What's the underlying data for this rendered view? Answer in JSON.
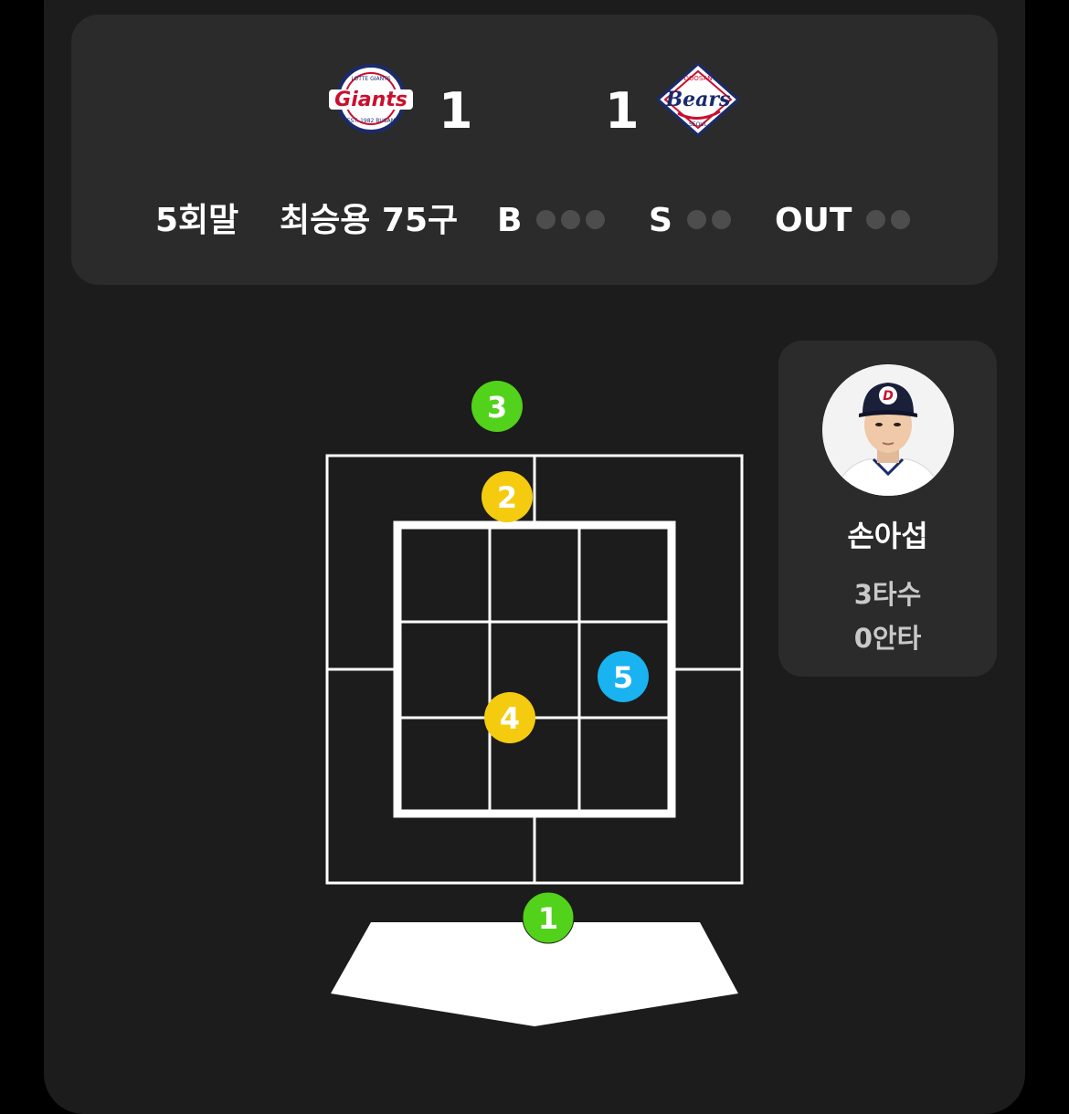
{
  "scoreboard": {
    "away_team": {
      "logo_icon": "lotte-giants-logo-icon",
      "logo_text": "Giants",
      "logo_ring_top": "LOTTE GIANTS",
      "logo_ring_bottom": "EST. 1982 BUSAN",
      "score": "1"
    },
    "home_team": {
      "logo_icon": "doosan-bears-logo-icon",
      "logo_text": "Bears",
      "logo_top": "DOOSAN",
      "logo_bottom": "SEOUL",
      "score": "1"
    },
    "inning": "5회말",
    "pitcher_pitch_count": "최승용 75구",
    "balls_label": "B",
    "balls": 0,
    "balls_max": 3,
    "strikes_label": "S",
    "strikes": 0,
    "strikes_max": 2,
    "outs_label": "OUT",
    "outs": 0,
    "outs_max": 2
  },
  "pitches": [
    {
      "number": "1",
      "result": "ball-green",
      "color": "#52d21a"
    },
    {
      "number": "2",
      "result": "foul-yellow",
      "color": "#f5cb0f"
    },
    {
      "number": "3",
      "result": "ball-green",
      "color": "#52d21a"
    },
    {
      "number": "4",
      "result": "foul-yellow",
      "color": "#f5cb0f"
    },
    {
      "number": "5",
      "result": "in-play-blue",
      "color": "#18b3f0"
    }
  ],
  "batter": {
    "avatar_icon": "player-photo-avatar",
    "name": "손아섭",
    "at_bats": "3타수",
    "hits": "0안타"
  },
  "colors": {
    "panel": "#1c1c1c",
    "card": "#2b2b2b",
    "dot_inactive": "#4d4d4d",
    "zone_line": "#ffffff"
  }
}
